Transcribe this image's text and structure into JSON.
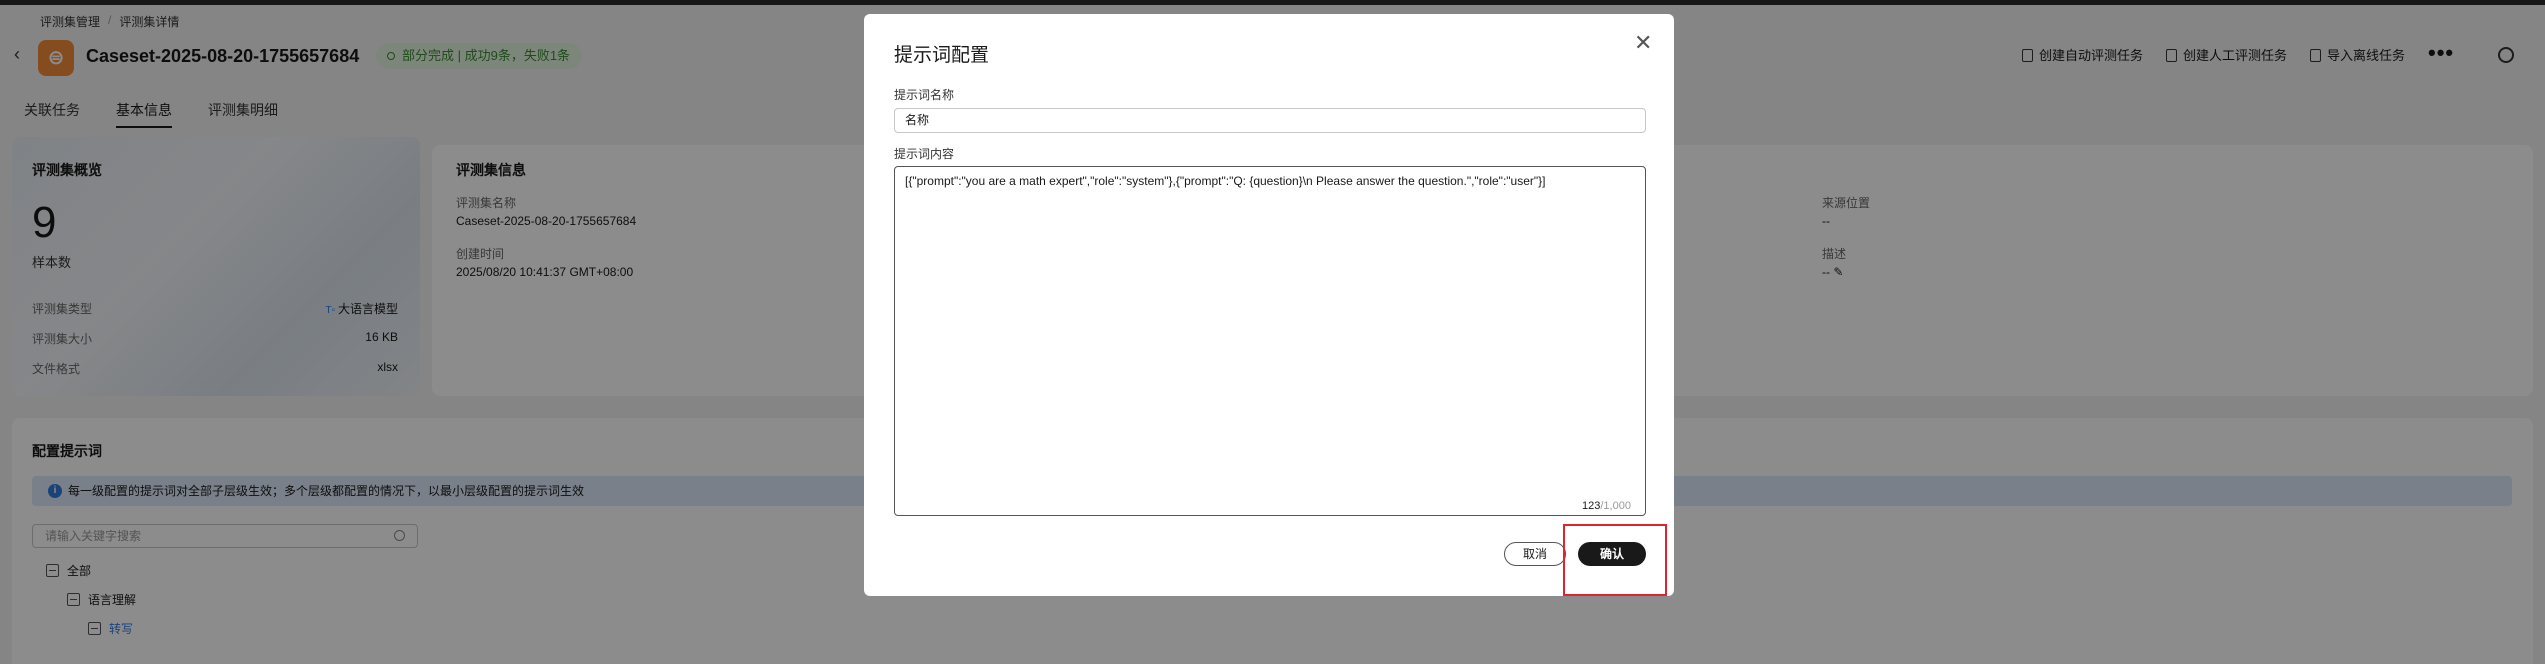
{
  "breadcrumb": {
    "parent": "评测集管理",
    "current": "评测集详情",
    "sep": "/"
  },
  "header": {
    "back_icon": "back-chevron-icon",
    "title": "Caseset-2025-08-20-1755657684",
    "status": "部分完成 | 成功9条，失败1条",
    "status_color": "#3a8a33",
    "actions": [
      "创建自动评测任务",
      "创建人工评测任务",
      "导入离线任务"
    ],
    "more": "•••"
  },
  "tabs": [
    {
      "label": "关联任务",
      "active": false
    },
    {
      "label": "基本信息",
      "active": true
    },
    {
      "label": "评测集明细",
      "active": false
    }
  ],
  "overview": {
    "title": "评测集概览",
    "sample_count": "9",
    "sample_label": "样本数",
    "rows": [
      {
        "label": "评测集类型",
        "value": "大语言模型"
      },
      {
        "label": "评测集大小",
        "value": "16 KB"
      },
      {
        "label": "文件格式",
        "value": "xlsx"
      }
    ]
  },
  "info": {
    "title": "评测集信息",
    "name_label": "评测集名称",
    "name_value": "Caseset-2025-08-20-1755657684",
    "created_label": "创建时间",
    "created_value": "2025/08/20 10:41:37 GMT+08:00",
    "source_label": "来源位置",
    "source_value": "--",
    "desc_label": "描述",
    "desc_value": "--"
  },
  "prompt_config": {
    "title": "配置提示词",
    "notice": "每一级配置的提示词对全部子层级生效；多个层级都配置的情况下，以最小层级配置的提示词生效",
    "search_placeholder": "请输入关键字搜索",
    "tree": [
      {
        "label": "全部",
        "level": 0,
        "selected": false
      },
      {
        "label": "语言理解",
        "level": 1,
        "selected": false
      },
      {
        "label": "转写",
        "level": 2,
        "selected": true
      }
    ]
  },
  "modal": {
    "title": "提示词配置",
    "name_label": "提示词名称",
    "name_value": "名称",
    "content_label": "提示词内容",
    "content_value": "[{\"prompt\":\"you are a math expert\",\"role\":\"system\"},{\"prompt\":\"Q: {question}\\n Please answer the question.\",\"role\":\"user\"}]",
    "count_current": "123",
    "count_max": "/1,000",
    "cancel_label": "取消",
    "confirm_label": "确认"
  },
  "colors": {
    "accent": "#2f7bdd",
    "highlight": "#e0242e",
    "logo": "#f28a3b"
  }
}
